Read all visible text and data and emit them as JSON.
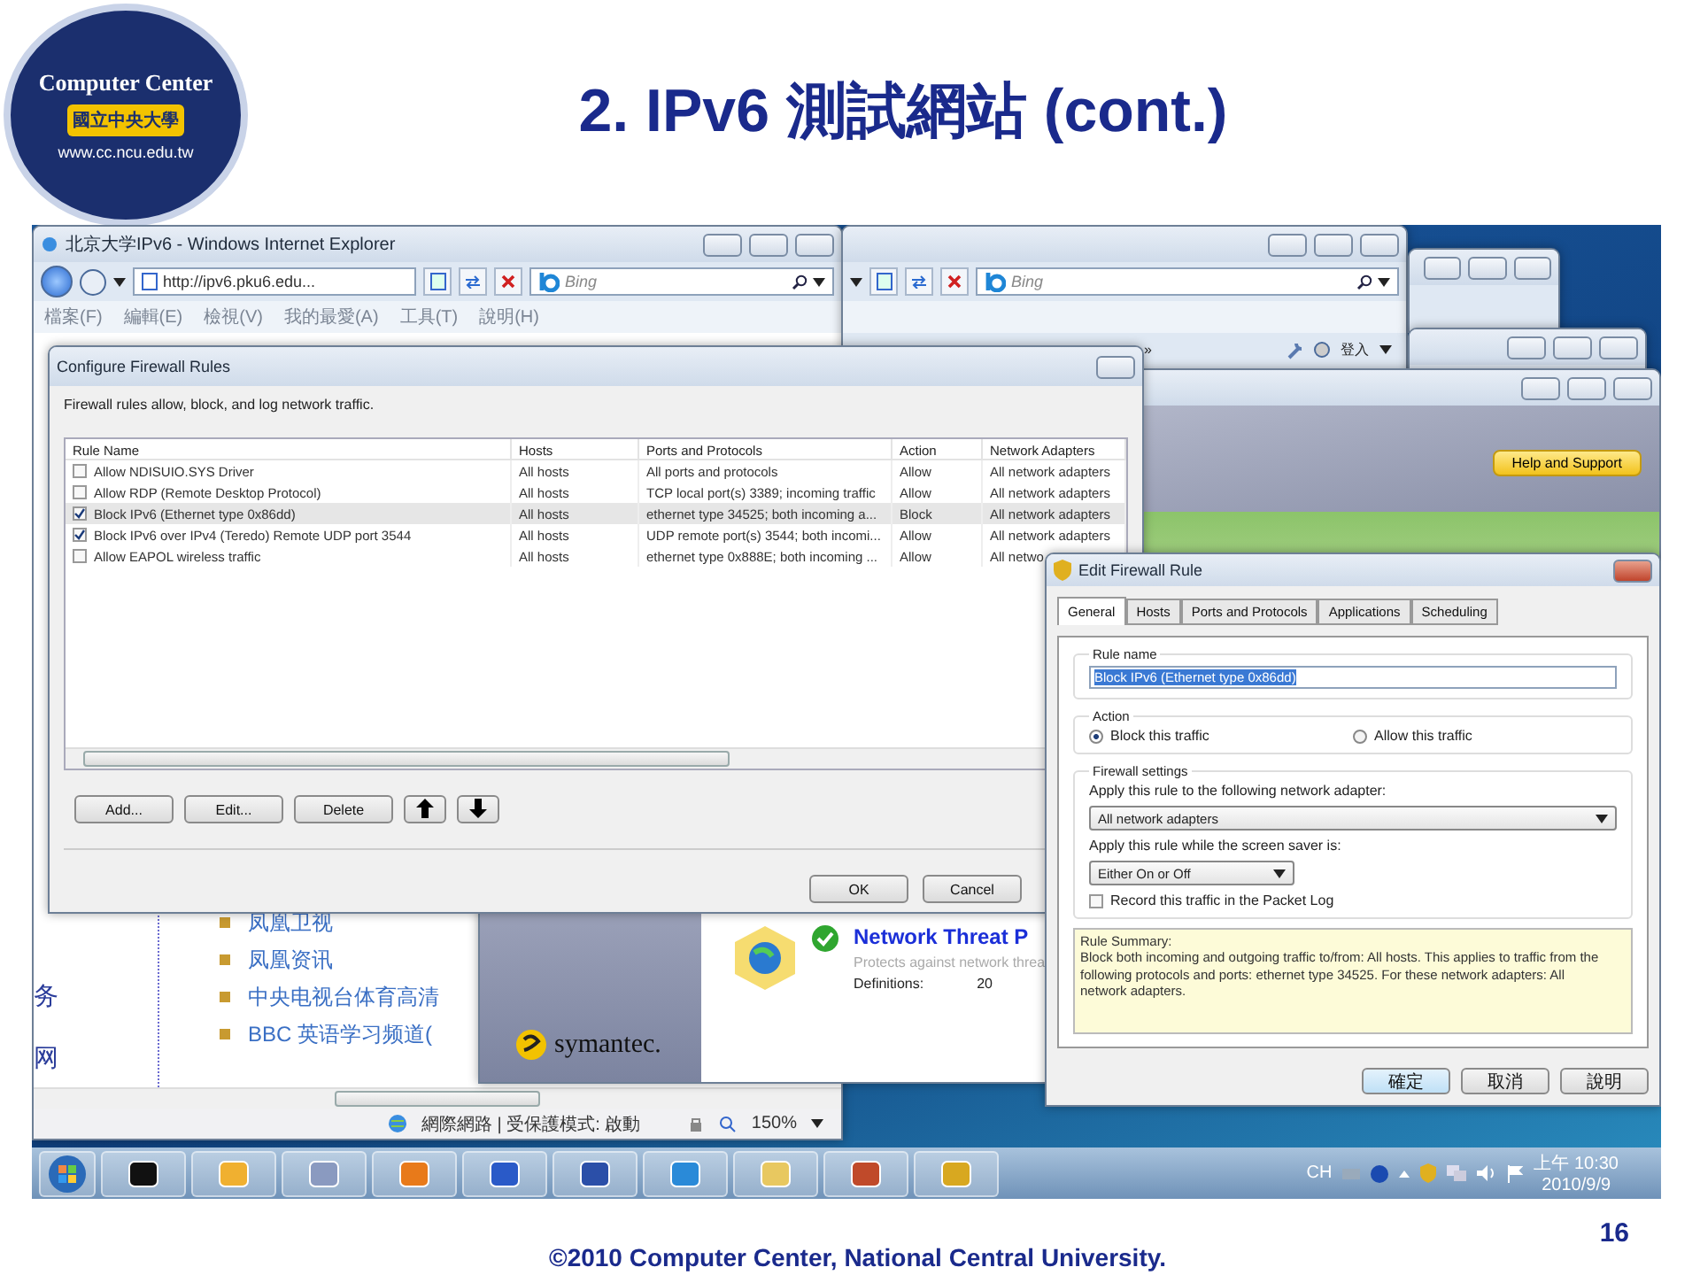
{
  "slide": {
    "title": "2. IPv6 測試網站 (cont.)",
    "logo": {
      "name": "Computer Center",
      "badge": "國立中央大學",
      "url": "www.cc.ncu.edu.tw"
    },
    "footer": "©2010 Computer Center, National Central University.",
    "page_number": "16"
  },
  "browser": {
    "title": "北京大学IPv6 - Windows Internet Explorer",
    "address": "http://ipv6.pku6.edu...",
    "search_placeholder": "Bing",
    "menu": [
      "檔案(F)",
      "編輯(E)",
      "檢視(V)",
      "我的最愛(A)",
      "工具(T)",
      "說明(H)"
    ],
    "links": [
      "凤凰卫视",
      "凤凰资讯",
      "中央电视台体育高清",
      "BBC 英语学习频道("
    ],
    "side_text": [
      "务",
      "网"
    ],
    "status": "網際網路 | 受保護模式: 啟動",
    "zoom": "150%"
  },
  "browser_2": {
    "search_placeholder": "Bing",
    "more": "»",
    "login": "登入"
  },
  "security_app": {
    "help_button": "Help and Support",
    "brand": "symantec.",
    "feature_title": "Network Threat P",
    "feature_desc": "Protects against network threa",
    "definitions_label": "Definitions:",
    "definitions_value": "20"
  },
  "firewall_rules": {
    "title": "Configure Firewall Rules",
    "description": "Firewall rules allow, block, and log network traffic.",
    "columns": [
      "Rule Name",
      "Hosts",
      "Ports and Protocols",
      "Action",
      "Network Adapters"
    ],
    "rows": [
      {
        "name": "Allow NDISUIO.SYS Driver",
        "hosts": "All hosts",
        "ports": "All ports and protocols",
        "action": "Allow",
        "adapters": "All network adapters",
        "checked": false,
        "selected": false
      },
      {
        "name": "Allow RDP (Remote Desktop Protocol)",
        "hosts": "All hosts",
        "ports": "TCP local port(s) 3389; incoming traffic",
        "action": "Allow",
        "adapters": "All network adapters",
        "checked": false,
        "selected": false
      },
      {
        "name": "Block IPv6 (Ethernet type 0x86dd)",
        "hosts": "All hosts",
        "ports": "ethernet type 34525; both incoming a...",
        "action": "Block",
        "adapters": "All network adapters",
        "checked": true,
        "selected": true
      },
      {
        "name": "Block IPv6 over IPv4 (Teredo) Remote UDP port 3544",
        "hosts": "All hosts",
        "ports": "UDP remote port(s) 3544; both incomi...",
        "action": "Allow",
        "adapters": "All network adapters",
        "checked": true,
        "selected": false
      },
      {
        "name": "Allow EAPOL wireless traffic",
        "hosts": "All hosts",
        "ports": "ethernet type 0x888E; both incoming ...",
        "action": "Allow",
        "adapters": "All netwo",
        "checked": false,
        "selected": false
      }
    ],
    "buttons": [
      "Add...",
      "Edit...",
      "Delete"
    ],
    "dialog_buttons": [
      "OK",
      "Cancel"
    ]
  },
  "edit_rule": {
    "title": "Edit Firewall Rule",
    "tabs": [
      {
        "label": "General",
        "selected": true
      },
      {
        "label": "Hosts",
        "selected": false
      },
      {
        "label": "Ports and Protocols",
        "selected": false
      },
      {
        "label": "Applications",
        "selected": false
      },
      {
        "label": "Scheduling",
        "selected": false
      }
    ],
    "rule_name_label": "Rule name",
    "rule_name": "Block IPv6 (Ethernet type 0x86dd)",
    "action_label": "Action",
    "actions": [
      {
        "label": "Block this traffic",
        "selected": true
      },
      {
        "label": "Allow this traffic",
        "selected": false
      }
    ],
    "settings_label": "Firewall settings",
    "adapter_label": "Apply this rule to the following network adapter:",
    "adapter_value": "All network adapters",
    "screensaver_label": "Apply this rule while the screen saver is:",
    "screensaver_value": "Either On or Off",
    "log": {
      "label": "Record this traffic in the Packet Log",
      "checked": false
    },
    "summary": "Rule Summary:\nBlock both incoming and outgoing traffic to/from: All hosts. This applies to traffic from the following protocols and ports: ethernet type 34525. For these network adapters: All network adapters.",
    "buttons": [
      "確定",
      "取消",
      "說明"
    ]
  },
  "taskbar": {
    "language": "CH",
    "time": "上午 10:30",
    "date": "2010/9/9"
  }
}
